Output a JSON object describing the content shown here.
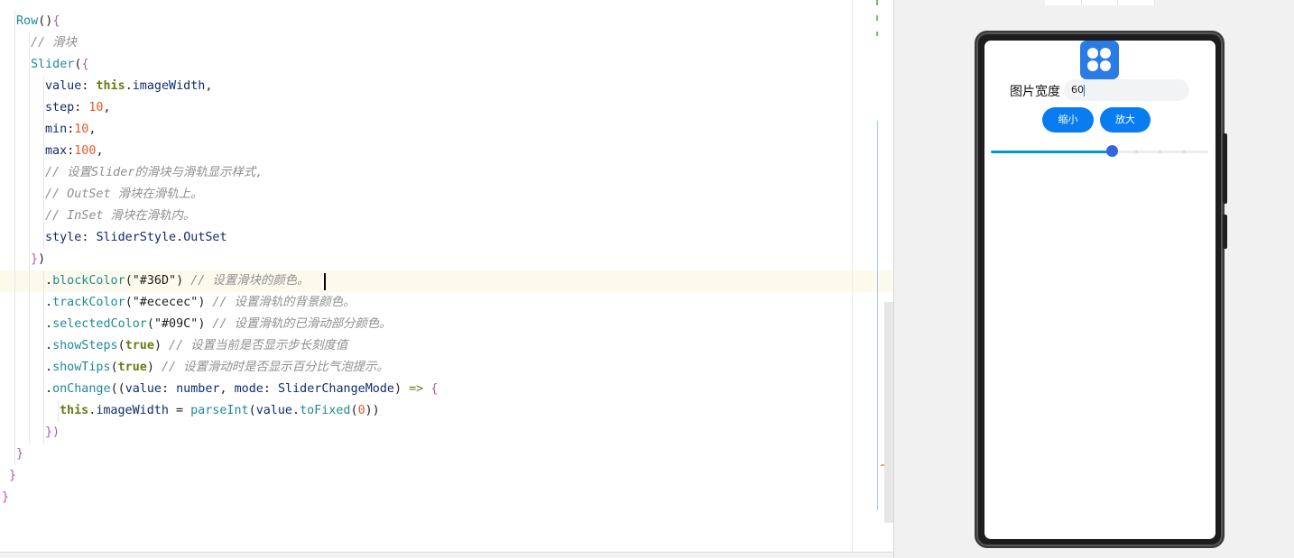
{
  "editor": {
    "lines": [
      {
        "indent": 1,
        "parts": [
          [
            "Row",
            "c-teal"
          ],
          [
            "()",
            "c-dark"
          ],
          [
            "{",
            "c-br1"
          ]
        ]
      },
      {
        "indent": 2,
        "parts": [
          [
            "// 滑块",
            "c-gray"
          ]
        ]
      },
      {
        "indent": 2,
        "parts": [
          [
            "Slider",
            "c-teal"
          ],
          [
            "(",
            "c-dark"
          ],
          [
            "{",
            "c-br1"
          ]
        ]
      },
      {
        "indent": 3,
        "parts": [
          [
            "value",
            "c-navy"
          ],
          [
            ": ",
            "c-dark"
          ],
          [
            "this",
            "c-olive"
          ],
          [
            ".",
            "c-dark"
          ],
          [
            "imageWidth",
            "c-navy"
          ],
          [
            ",",
            "c-dark"
          ]
        ]
      },
      {
        "indent": 3,
        "parts": [
          [
            "step",
            "c-navy"
          ],
          [
            ": ",
            "c-dark"
          ],
          [
            "10",
            "c-orange"
          ],
          [
            ",",
            "c-dark"
          ]
        ]
      },
      {
        "indent": 3,
        "parts": [
          [
            "min",
            "c-navy"
          ],
          [
            ":",
            "c-dark"
          ],
          [
            "10",
            "c-orange"
          ],
          [
            ",",
            "c-dark"
          ]
        ]
      },
      {
        "indent": 3,
        "parts": [
          [
            "max",
            "c-navy"
          ],
          [
            ":",
            "c-dark"
          ],
          [
            "100",
            "c-orange"
          ],
          [
            ",",
            "c-dark"
          ]
        ]
      },
      {
        "indent": 3,
        "parts": [
          [
            "// 设置Slider的滑块与滑轨显示样式,",
            "c-gray"
          ]
        ]
      },
      {
        "indent": 3,
        "parts": [
          [
            "// OutSet 滑块在滑轨上。",
            "c-gray"
          ]
        ]
      },
      {
        "indent": 3,
        "parts": [
          [
            "// InSet 滑块在滑轨内。",
            "c-gray"
          ]
        ]
      },
      {
        "indent": 3,
        "parts": [
          [
            "style",
            "c-navy"
          ],
          [
            ": ",
            "c-dark"
          ],
          [
            "SliderStyle",
            "c-navy"
          ],
          [
            ".",
            "c-dark"
          ],
          [
            "OutSet",
            "c-navy"
          ]
        ]
      },
      {
        "indent": 2,
        "parts": [
          [
            "}",
            "c-br1"
          ],
          [
            ")",
            "c-dark"
          ]
        ]
      },
      {
        "indent": 3,
        "current": true,
        "parts": [
          [
            ".",
            "c-dark"
          ],
          [
            "blockColor",
            "c-teal"
          ],
          [
            "(",
            "c-dark"
          ],
          [
            "\"#36D\"",
            "c-str"
          ],
          [
            ")",
            "c-dark"
          ],
          [
            " // 设置滑块的颜色。",
            "c-gray"
          ]
        ]
      },
      {
        "indent": 3,
        "parts": [
          [
            ".",
            "c-dark"
          ],
          [
            "trackColor",
            "c-teal"
          ],
          [
            "(",
            "c-dark"
          ],
          [
            "\"#ececec\"",
            "c-str"
          ],
          [
            ")",
            "c-dark"
          ],
          [
            " // 设置滑轨的背景颜色。",
            "c-gray"
          ]
        ]
      },
      {
        "indent": 3,
        "parts": [
          [
            ".",
            "c-dark"
          ],
          [
            "selectedColor",
            "c-teal"
          ],
          [
            "(",
            "c-dark"
          ],
          [
            "\"#09C\"",
            "c-str"
          ],
          [
            ")",
            "c-dark"
          ],
          [
            " // 设置滑轨的已滑动部分颜色。",
            "c-gray"
          ]
        ]
      },
      {
        "indent": 3,
        "parts": [
          [
            ".",
            "c-dark"
          ],
          [
            "showSteps",
            "c-teal"
          ],
          [
            "(",
            "c-dark"
          ],
          [
            "true",
            "c-olive"
          ],
          [
            ")",
            "c-dark"
          ],
          [
            " // 设置当前是否显示步长刻度值",
            "c-gray"
          ]
        ]
      },
      {
        "indent": 3,
        "parts": [
          [
            ".",
            "c-dark"
          ],
          [
            "showTips",
            "c-teal"
          ],
          [
            "(",
            "c-dark"
          ],
          [
            "true",
            "c-olive"
          ],
          [
            ")",
            "c-dark"
          ],
          [
            " // 设置滑动时是否显示百分比气泡提示。",
            "c-gray"
          ]
        ]
      },
      {
        "indent": 3,
        "parts": [
          [
            ".",
            "c-dark"
          ],
          [
            "onChange",
            "c-teal"
          ],
          [
            "((",
            "c-dark"
          ],
          [
            "value",
            "c-navy"
          ],
          [
            ": ",
            "c-dark"
          ],
          [
            "number",
            "c-navy"
          ],
          [
            ", ",
            "c-dark"
          ],
          [
            "mode",
            "c-navy"
          ],
          [
            ": ",
            "c-dark"
          ],
          [
            "SliderChangeMode",
            "c-navy"
          ],
          [
            ") ",
            "c-dark"
          ],
          [
            "=>",
            "c-green"
          ],
          [
            " ",
            "c-dark"
          ],
          [
            "{",
            "c-br1"
          ]
        ]
      },
      {
        "indent": 4,
        "parts": [
          [
            "this",
            "c-olive"
          ],
          [
            ".",
            "c-dark"
          ],
          [
            "imageWidth",
            "c-navy"
          ],
          [
            " = ",
            "c-dark"
          ],
          [
            "parseInt",
            "c-teal"
          ],
          [
            "(",
            "c-dark"
          ],
          [
            "value",
            "c-navy"
          ],
          [
            ".",
            "c-dark"
          ],
          [
            "toFixed",
            "c-teal"
          ],
          [
            "(",
            "c-dark"
          ],
          [
            "0",
            "c-orange"
          ],
          [
            "))",
            "c-dark"
          ]
        ]
      },
      {
        "indent": 3,
        "parts": [
          [
            "})",
            "c-br1"
          ]
        ]
      },
      {
        "indent": 1,
        "parts": [
          [
            "}",
            "c-br1"
          ]
        ]
      },
      {
        "indent": 0.5,
        "parts": [
          [
            "}",
            "c-br1"
          ]
        ]
      },
      {
        "indent": 0,
        "parts": [
          [
            "}",
            "c-br1"
          ]
        ]
      }
    ]
  },
  "preview": {
    "label": "图片宽度",
    "input_value": "60",
    "shrink_label": "缩小",
    "enlarge_label": "放大",
    "slider": {
      "min": 10,
      "max": 100,
      "step": 10,
      "value": 60,
      "block_color": "#3366DD",
      "track_color": "#ececec",
      "selected_color": "#0099CC"
    },
    "button_color": "#0a7cf2",
    "app_icon": "clover-app-icon"
  }
}
